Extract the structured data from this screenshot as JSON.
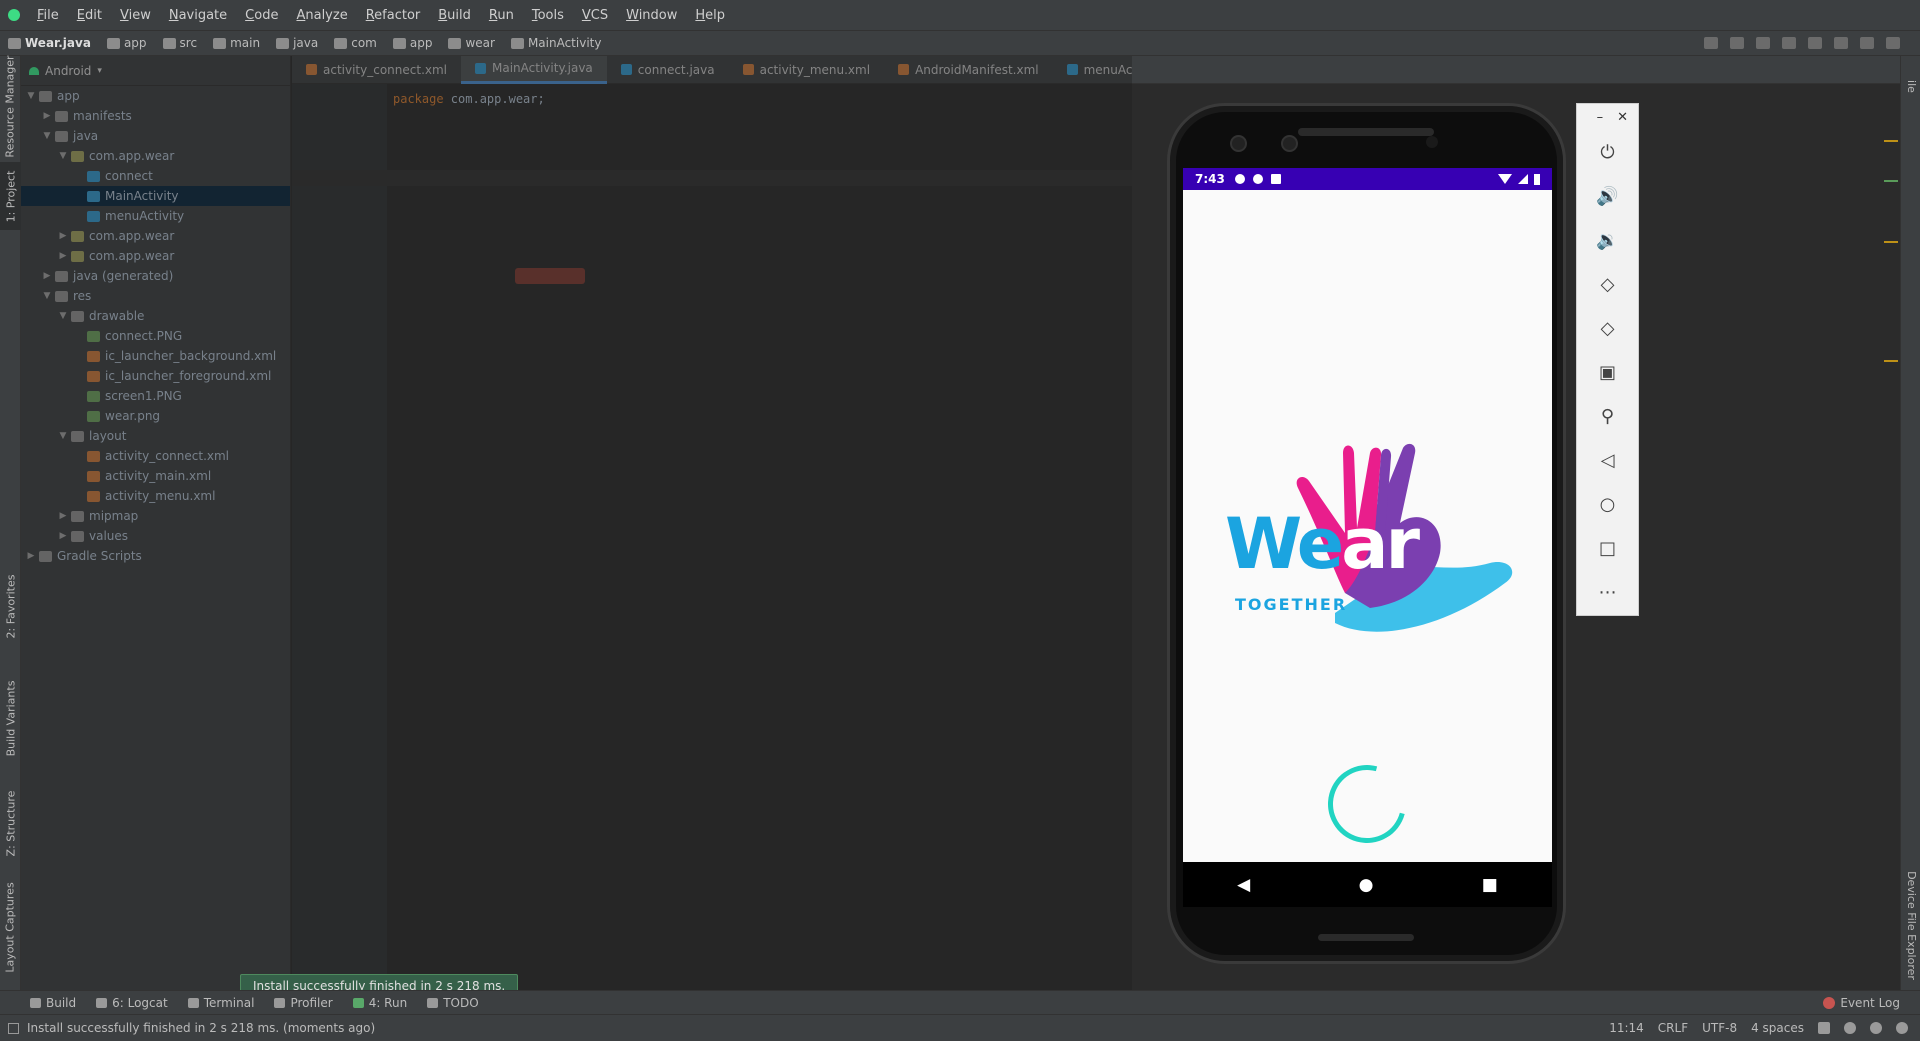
{
  "menu": [
    "File",
    "Edit",
    "View",
    "Navigate",
    "Code",
    "Analyze",
    "Refactor",
    "Build",
    "Run",
    "Tools",
    "VCS",
    "Window",
    "Help"
  ],
  "breadcrumbs": [
    "Wear.java",
    "app",
    "src",
    "main",
    "java",
    "com",
    "app",
    "wear",
    "MainActivity"
  ],
  "left_tabs": {
    "resource_manager": "Resource Manager",
    "project": "1: Project",
    "favorites": "2: Favorites",
    "build_variants": "Build Variants",
    "structure": "Z: Structure",
    "layout_captures": "Layout Captures"
  },
  "project_panel": {
    "view_mode": "Android",
    "tree": [
      {
        "depth": 0,
        "label": "app",
        "icon": "folder",
        "expanded": true
      },
      {
        "depth": 1,
        "label": "manifests",
        "icon": "folder",
        "expanded": false
      },
      {
        "depth": 1,
        "label": "java",
        "icon": "folder",
        "expanded": true
      },
      {
        "depth": 2,
        "label": "com.app.wear",
        "icon": "pkg",
        "expanded": true
      },
      {
        "depth": 3,
        "label": "connect",
        "icon": "cls"
      },
      {
        "depth": 3,
        "label": "MainActivity",
        "icon": "cls",
        "selected": true
      },
      {
        "depth": 3,
        "label": "menuActivity",
        "icon": "cls"
      },
      {
        "depth": 2,
        "label": "com.app.wear",
        "icon": "pkg",
        "expanded": false
      },
      {
        "depth": 2,
        "label": "com.app.wear",
        "icon": "pkg",
        "expanded": false
      },
      {
        "depth": 1,
        "label": "java (generated)",
        "icon": "folder",
        "expanded": false
      },
      {
        "depth": 1,
        "label": "res",
        "icon": "folder",
        "expanded": true
      },
      {
        "depth": 2,
        "label": "drawable",
        "icon": "folder",
        "expanded": true
      },
      {
        "depth": 3,
        "label": "connect.PNG",
        "icon": "img"
      },
      {
        "depth": 3,
        "label": "ic_launcher_background.xml",
        "icon": "xml"
      },
      {
        "depth": 3,
        "label": "ic_launcher_foreground.xml",
        "icon": "xml"
      },
      {
        "depth": 3,
        "label": "screen1.PNG",
        "icon": "img"
      },
      {
        "depth": 3,
        "label": "wear.png",
        "icon": "img"
      },
      {
        "depth": 2,
        "label": "layout",
        "icon": "folder",
        "expanded": true
      },
      {
        "depth": 3,
        "label": "activity_connect.xml",
        "icon": "xml"
      },
      {
        "depth": 3,
        "label": "activity_main.xml",
        "icon": "xml"
      },
      {
        "depth": 3,
        "label": "activity_menu.xml",
        "icon": "xml"
      },
      {
        "depth": 2,
        "label": "mipmap",
        "icon": "folder",
        "expanded": false
      },
      {
        "depth": 2,
        "label": "values",
        "icon": "folder",
        "expanded": false
      },
      {
        "depth": 0,
        "label": "Gradle Scripts",
        "icon": "folder",
        "expanded": false
      }
    ]
  },
  "editor_tabs": [
    {
      "label": "activity_connect.xml",
      "icon": "xml"
    },
    {
      "label": "MainActivity.java",
      "icon": "cls",
      "active": true
    },
    {
      "label": "connect.java",
      "icon": "cls"
    },
    {
      "label": "activity_menu.xml",
      "icon": "xml"
    },
    {
      "label": "AndroidManifest.xml",
      "icon": "xml"
    },
    {
      "label": "menuActivity.java",
      "icon": "cls"
    }
  ],
  "code": {
    "first_line_keyword": "package",
    "first_line_rest": " com.app.wear;"
  },
  "right_tabs": {
    "top": "ile",
    "device_file_explorer": "Device File Explorer"
  },
  "phone": {
    "time": "7:43",
    "logo_word_a": "We",
    "logo_word_b": "ar",
    "logo_tagline": "TOGETHER",
    "colors": {
      "statusbar": "#3700b3",
      "logo_blue": "#1ba4e0",
      "logo_pink": "#e91e8c",
      "logo_purple": "#7b3fb0",
      "spinner": "#21d4c2"
    },
    "nav": [
      "back-icon",
      "home-icon",
      "recents-icon"
    ]
  },
  "emulator_toolbar": [
    "power-icon",
    "volume-up-icon",
    "volume-down-icon",
    "rotate-left-icon",
    "rotate-right-icon",
    "camera-icon",
    "zoom-icon",
    "back-icon",
    "home-icon",
    "overview-icon",
    "more-icon"
  ],
  "bottom_tools": [
    {
      "label": "Build",
      "icon": "hammer-icon"
    },
    {
      "label": "6: Logcat",
      "icon": "logcat-icon"
    },
    {
      "label": "Terminal",
      "icon": "terminal-icon"
    },
    {
      "label": "Profiler",
      "icon": "profiler-icon"
    },
    {
      "label": "4: Run",
      "icon": "run-icon",
      "cls": "run"
    },
    {
      "label": "TODO",
      "icon": "todo-icon"
    }
  ],
  "event_log": "Event Log",
  "balloon": "Install successfully finished in 2 s 218 ms.",
  "status": {
    "message": "Install successfully finished in 2 s 218 ms. (moments ago)",
    "position": "11:14",
    "line_sep": "CRLF",
    "encoding": "UTF-8",
    "indent": "4 spaces"
  }
}
